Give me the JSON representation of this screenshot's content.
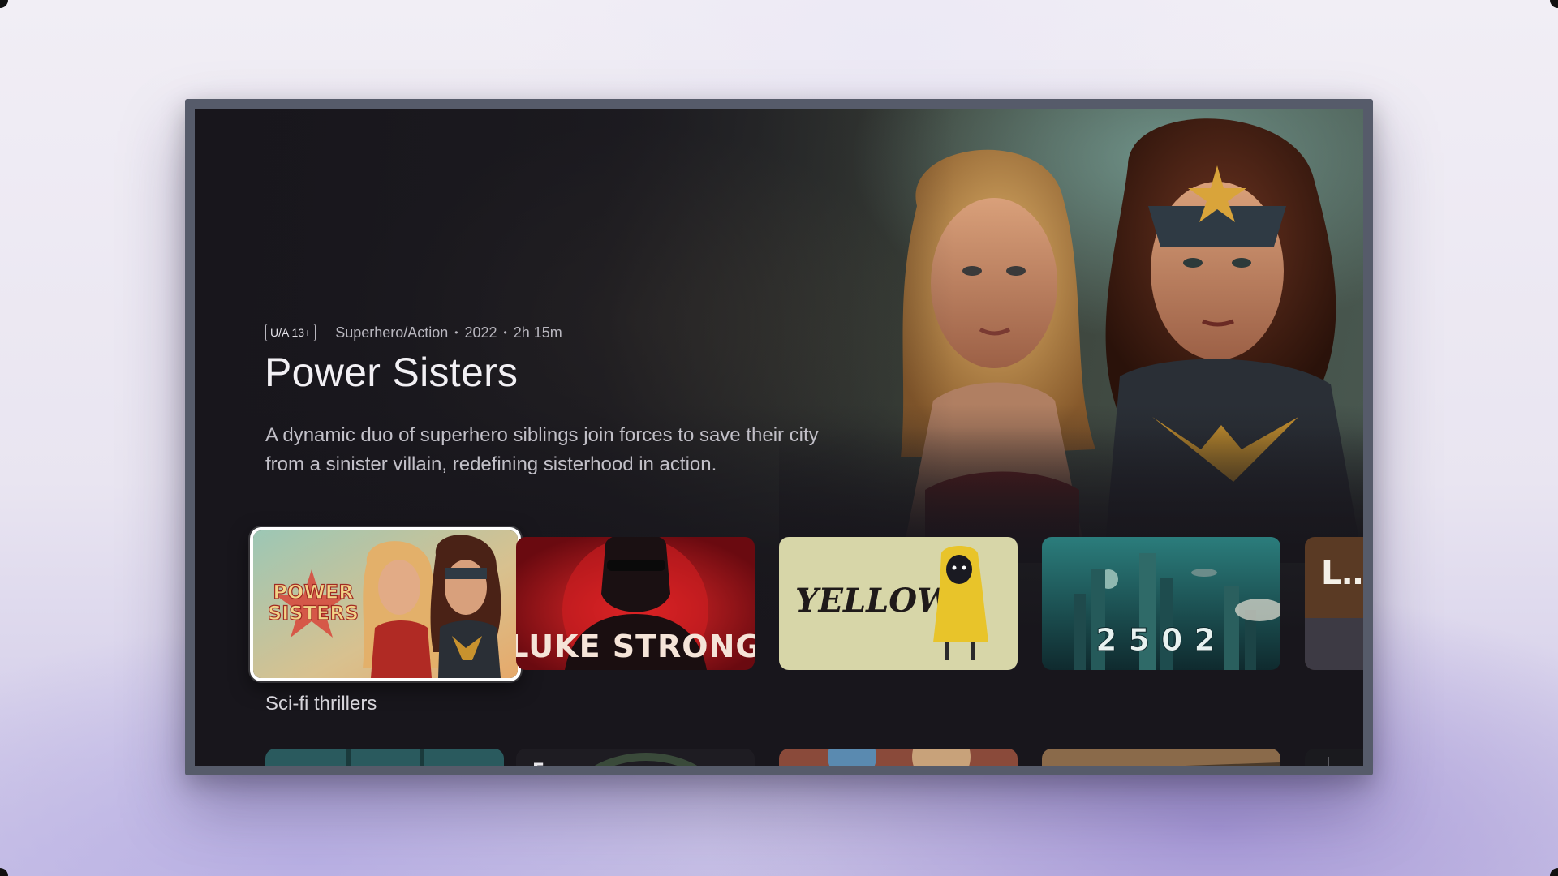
{
  "hero": {
    "rating": "U/A 13+",
    "genre": "Superhero/Action",
    "year": "2022",
    "duration": "2h 15m",
    "separator": "•",
    "title": "Power Sisters",
    "description": "A dynamic duo of superhero siblings join forces to save their city from a sinister villain, redefining sisterhood in action."
  },
  "row1": {
    "cards": [
      {
        "title": "POWER SISTERS",
        "line1": "POWER",
        "line2": "SISTERS",
        "focused": true
      },
      {
        "title": "LUKE STRONG"
      },
      {
        "title": "YELLOW"
      },
      {
        "title": "2502"
      },
      {
        "title": "L…"
      }
    ]
  },
  "row2": {
    "section_title": "Sci-fi thrillers",
    "cards": [
      {
        "title": ""
      },
      {
        "title": "E"
      },
      {
        "title": ""
      },
      {
        "title": ""
      },
      {
        "title": ""
      }
    ]
  },
  "colors": {
    "accent": "#ffffff",
    "screen_bg": "#18161c",
    "bezel": "#565b6a"
  }
}
